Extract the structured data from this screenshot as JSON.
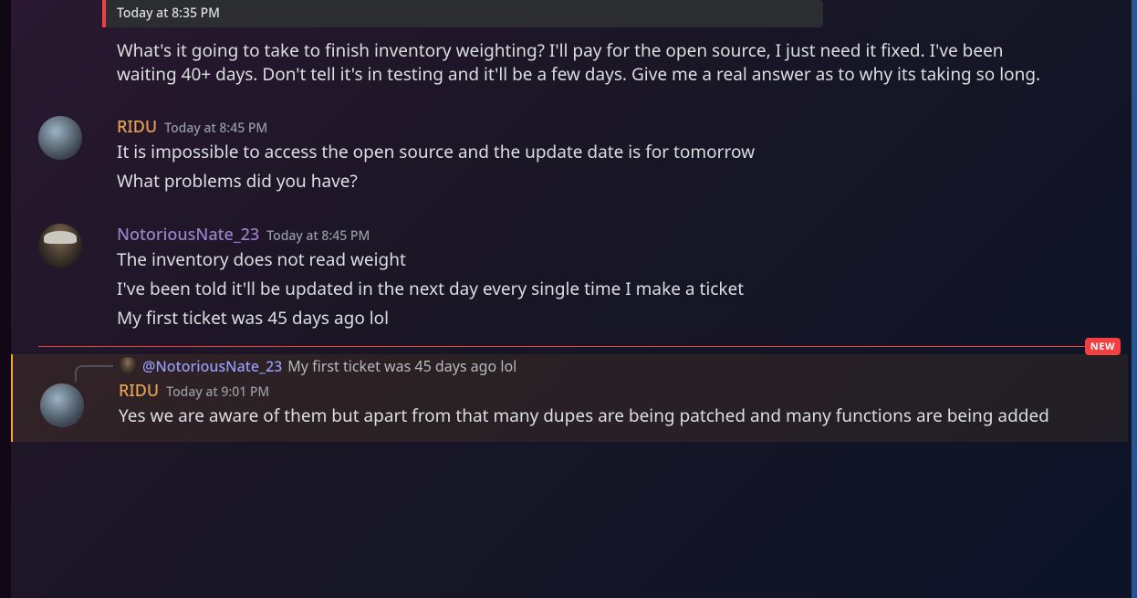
{
  "embed": {
    "timestamp": "Today at 8:35 PM"
  },
  "messages": [
    {
      "id": "m0",
      "text": "What's it going to take to finish inventory weighting? I'll pay for the open source, I just need it fixed. I've been waiting 40+ days. Don't tell it's in testing and it'll be a few days. Give me a real answer as to why its taking so long."
    },
    {
      "id": "m1",
      "author": "RIDU",
      "timestamp": "Today at 8:45 PM",
      "lines": [
        "It is impossible to access the open source and the update date is for tomorrow",
        "What problems did you have?"
      ]
    },
    {
      "id": "m2",
      "author": "NotoriousNate_23",
      "timestamp": "Today at 8:45 PM",
      "lines": [
        "The inventory does not read weight",
        "I've been told it'll be updated in the next day every single time I make a ticket",
        "My first ticket was 45 days ago lol"
      ]
    }
  ],
  "divider": {
    "label": "NEW"
  },
  "reply": {
    "ref_author": "@NotoriousNate_23",
    "ref_text": "My first ticket was 45 days ago lol",
    "author": "RIDU",
    "timestamp": "Today at 9:01 PM",
    "text": "Yes we are aware of them but apart from that many dupes are being patched and many functions are being added"
  }
}
